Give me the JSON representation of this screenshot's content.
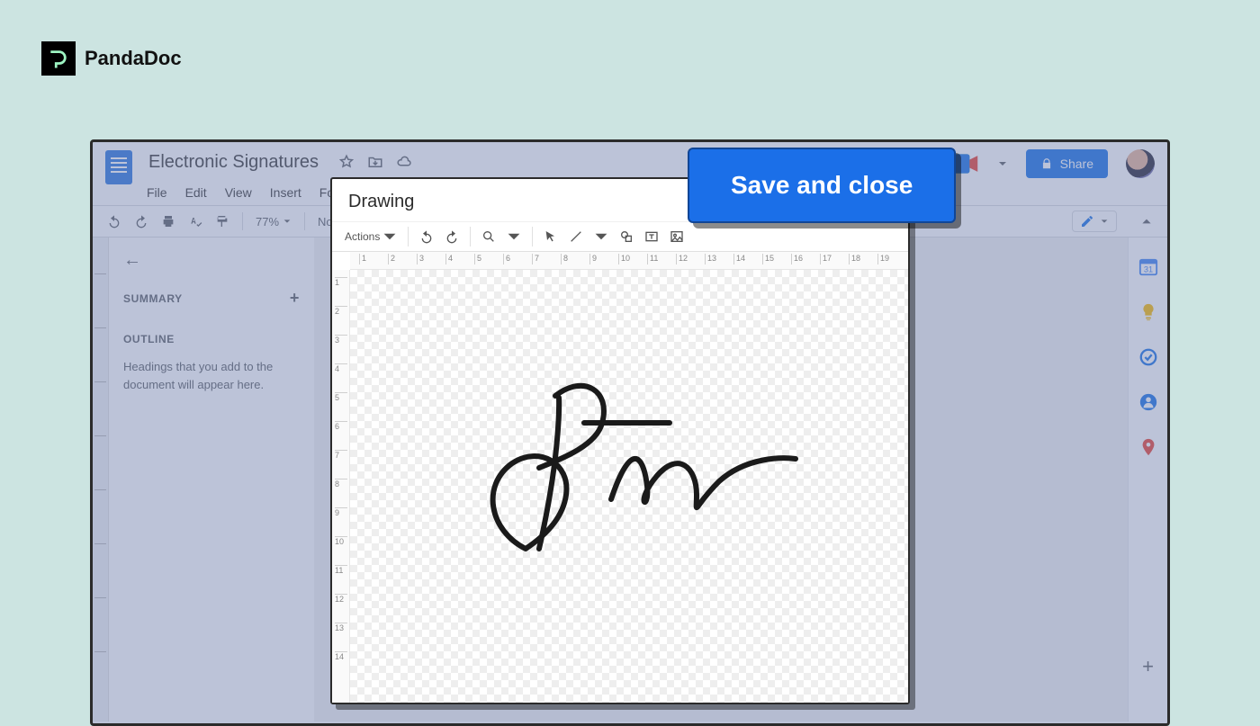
{
  "brand": {
    "name": "PandaDoc"
  },
  "doc": {
    "title": "Electronic Signatures",
    "menus": [
      "File",
      "Edit",
      "View",
      "Insert",
      "Form"
    ],
    "zoom": "77%",
    "style": "No",
    "share_label": "Share"
  },
  "outline": {
    "summary_label": "SUMMARY",
    "outline_label": "OUTLINE",
    "empty_text": "Headings that you add to the document will appear here."
  },
  "drawing": {
    "title": "Drawing",
    "actions_label": "Actions",
    "h_ticks": [
      "1",
      "2",
      "3",
      "4",
      "5",
      "6",
      "7",
      "8",
      "9",
      "10",
      "11",
      "12",
      "13",
      "14",
      "15",
      "16",
      "17",
      "18",
      "19"
    ],
    "v_ticks": [
      "1",
      "2",
      "3",
      "4",
      "5",
      "6",
      "7",
      "8",
      "9",
      "10",
      "11",
      "12",
      "13",
      "14"
    ]
  },
  "callout": {
    "save_and_close": "Save and close"
  }
}
